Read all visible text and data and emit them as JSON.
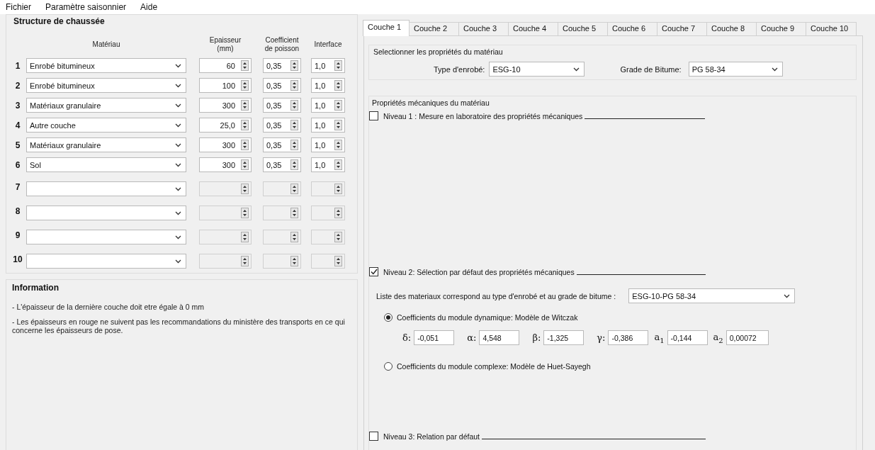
{
  "menu": [
    "Fichier",
    "Paramètre saisonnier",
    "Aide"
  ],
  "structure": {
    "title": "Structure de chaussée",
    "columns": [
      "Matériau",
      "Epaisseur\n(mm)",
      "Coefficient\nde poisson",
      "Interface"
    ],
    "rows": [
      {
        "number": "1",
        "material": "Enrobé bitumineux",
        "thickness": "60",
        "poisson": "0,35",
        "interface": "1,0",
        "disabled": false
      },
      {
        "number": "2",
        "material": "Enrobé bitumineux",
        "thickness": "100",
        "poisson": "0,35",
        "interface": "1,0",
        "disabled": false
      },
      {
        "number": "3",
        "material": "Matériaux granulaire",
        "thickness": "300",
        "poisson": "0,35",
        "interface": "1,0",
        "disabled": false
      },
      {
        "number": "4",
        "material": "Autre couche",
        "thickness": "25,0",
        "poisson": "0,35",
        "interface": "1,0",
        "disabled": false
      },
      {
        "number": "5",
        "material": "Matériaux granulaire",
        "thickness": "300",
        "poisson": "0,35",
        "interface": "1,0",
        "disabled": false
      },
      {
        "number": "6",
        "material": "Sol",
        "thickness": "300",
        "poisson": "0,35",
        "interface": "1,0",
        "disabled": false
      },
      {
        "number": "7",
        "disabled": true
      },
      {
        "number": "8",
        "disabled": true
      },
      {
        "number": "9",
        "disabled": true
      },
      {
        "number": "10",
        "disabled": true
      }
    ]
  },
  "information": {
    "title": "Information",
    "lines": [
      "- L'épaisseur de la dernière couche doit etre égale à 0 mm",
      "- Les épaisseurs en rouge ne suivent pas les recommandations du ministère des transports en ce qui concerne les épaisseurs de pose."
    ]
  },
  "tabs": [
    {
      "label": "Couche 1",
      "selected": true
    },
    {
      "label": "Couche 2",
      "selected": false
    },
    {
      "label": "Couche 3",
      "selected": false
    },
    {
      "label": "Couche 4",
      "selected": false
    },
    {
      "label": "Couche 5",
      "selected": false
    },
    {
      "label": "Couche 6",
      "selected": false
    },
    {
      "label": "Couche 7",
      "selected": false
    },
    {
      "label": "Couche 8",
      "selected": false
    },
    {
      "label": "Couche 9",
      "selected": false
    },
    {
      "label": "Couche 10",
      "selected": false
    }
  ],
  "material_selection": {
    "title": "Selectionner les propriétés du matériau",
    "mix_type": {
      "label": "Type d'enrobé:",
      "value": "ESG-10"
    },
    "binder_grade": {
      "label": "Grade de Bitume:",
      "value": "PG 58-34"
    }
  },
  "mechanical": {
    "title": "Propriétés mécaniques du matériau",
    "levels": [
      {
        "label": "Niveau 1 : Mesure en laboratoire des propriétés mécaniques",
        "checked": false
      },
      {
        "label": "Niveau 2: Sélection par défaut des propriétés mécaniques",
        "checked": true
      },
      {
        "label": "Niveau 3: Relation par défaut",
        "checked": false
      }
    ],
    "material_list": {
      "label": "Liste des materiaux correspond au type d'enrobé et au grade de bitume :",
      "value": "ESG-10-PG 58-34"
    },
    "models": [
      {
        "label": "Coefficients du module dynamique: Modèle de Witczak",
        "selected": true
      },
      {
        "label": "Coefficients du module complexe: Modèle de Huet-Sayegh",
        "selected": false
      }
    ],
    "coefficients": [
      {
        "symbol": "δ:",
        "value": "-0,051"
      },
      {
        "symbol": "α:",
        "value": "4,548"
      },
      {
        "symbol": "β:",
        "value": "-1,325"
      },
      {
        "symbol": "γ:",
        "value": "-0,386"
      },
      {
        "symbol": "a$_{1}$",
        "value": "-0,144"
      },
      {
        "symbol": "a$_{2}$",
        "value": "0,00072"
      }
    ]
  }
}
